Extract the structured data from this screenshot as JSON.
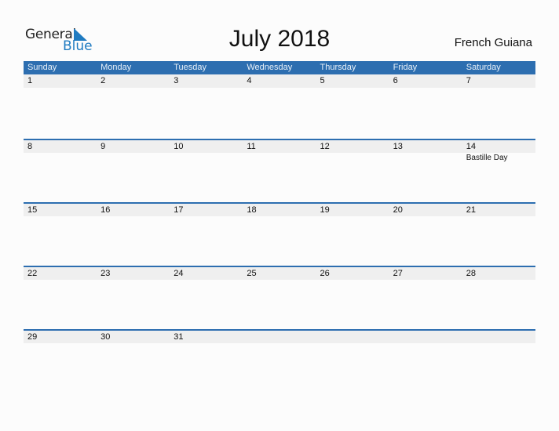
{
  "logo": {
    "line1": "General",
    "line2": "Blue"
  },
  "header": {
    "title": "July 2018",
    "country": "French Guiana"
  },
  "colors": {
    "accent": "#2d6eb0",
    "logo_blue": "#1f7bc1",
    "row_bg": "#efefef"
  },
  "weekdays": [
    "Sunday",
    "Monday",
    "Tuesday",
    "Wednesday",
    "Thursday",
    "Friday",
    "Saturday"
  ],
  "weeks": [
    {
      "days": [
        "1",
        "2",
        "3",
        "4",
        "5",
        "6",
        "7"
      ],
      "holidays": [
        "",
        "",
        "",
        "",
        "",
        "",
        ""
      ]
    },
    {
      "days": [
        "8",
        "9",
        "10",
        "11",
        "12",
        "13",
        "14"
      ],
      "holidays": [
        "",
        "",
        "",
        "",
        "",
        "",
        "Bastille Day"
      ]
    },
    {
      "days": [
        "15",
        "16",
        "17",
        "18",
        "19",
        "20",
        "21"
      ],
      "holidays": [
        "",
        "",
        "",
        "",
        "",
        "",
        ""
      ]
    },
    {
      "days": [
        "22",
        "23",
        "24",
        "25",
        "26",
        "27",
        "28"
      ],
      "holidays": [
        "",
        "",
        "",
        "",
        "",
        "",
        ""
      ]
    },
    {
      "days": [
        "29",
        "30",
        "31",
        "",
        "",
        "",
        ""
      ],
      "holidays": [
        "",
        "",
        "",
        "",
        "",
        "",
        ""
      ]
    }
  ]
}
